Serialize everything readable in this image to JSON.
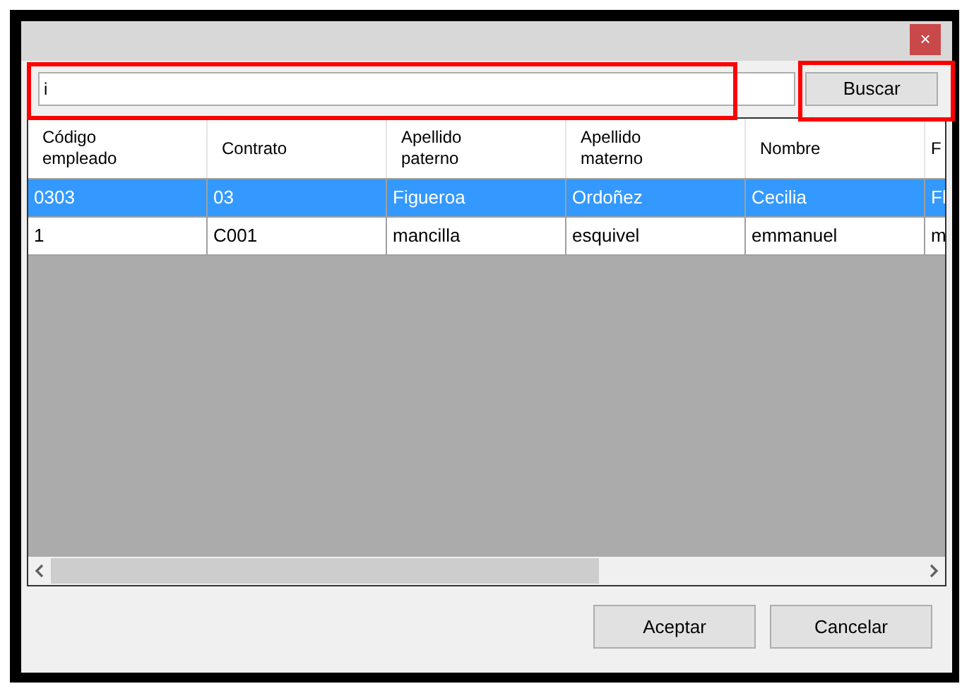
{
  "window": {
    "close": "×"
  },
  "search": {
    "value": "i",
    "button": "Buscar"
  },
  "table": {
    "columns": [
      "Código\nempleado",
      "Contrato",
      "Apellido\npaterno",
      "Apellido\nmaterno",
      "Nombre",
      "F"
    ],
    "rows": [
      {
        "selected": true,
        "cells": [
          "0303",
          "03",
          "Figueroa",
          "Ordoñez",
          "Cecilia",
          "Fl"
        ]
      },
      {
        "selected": false,
        "cells": [
          "1",
          "C001",
          "mancilla",
          "esquivel",
          "emmanuel",
          "m"
        ]
      }
    ]
  },
  "buttons": [
    "Aceptar",
    "Cancelar"
  ]
}
